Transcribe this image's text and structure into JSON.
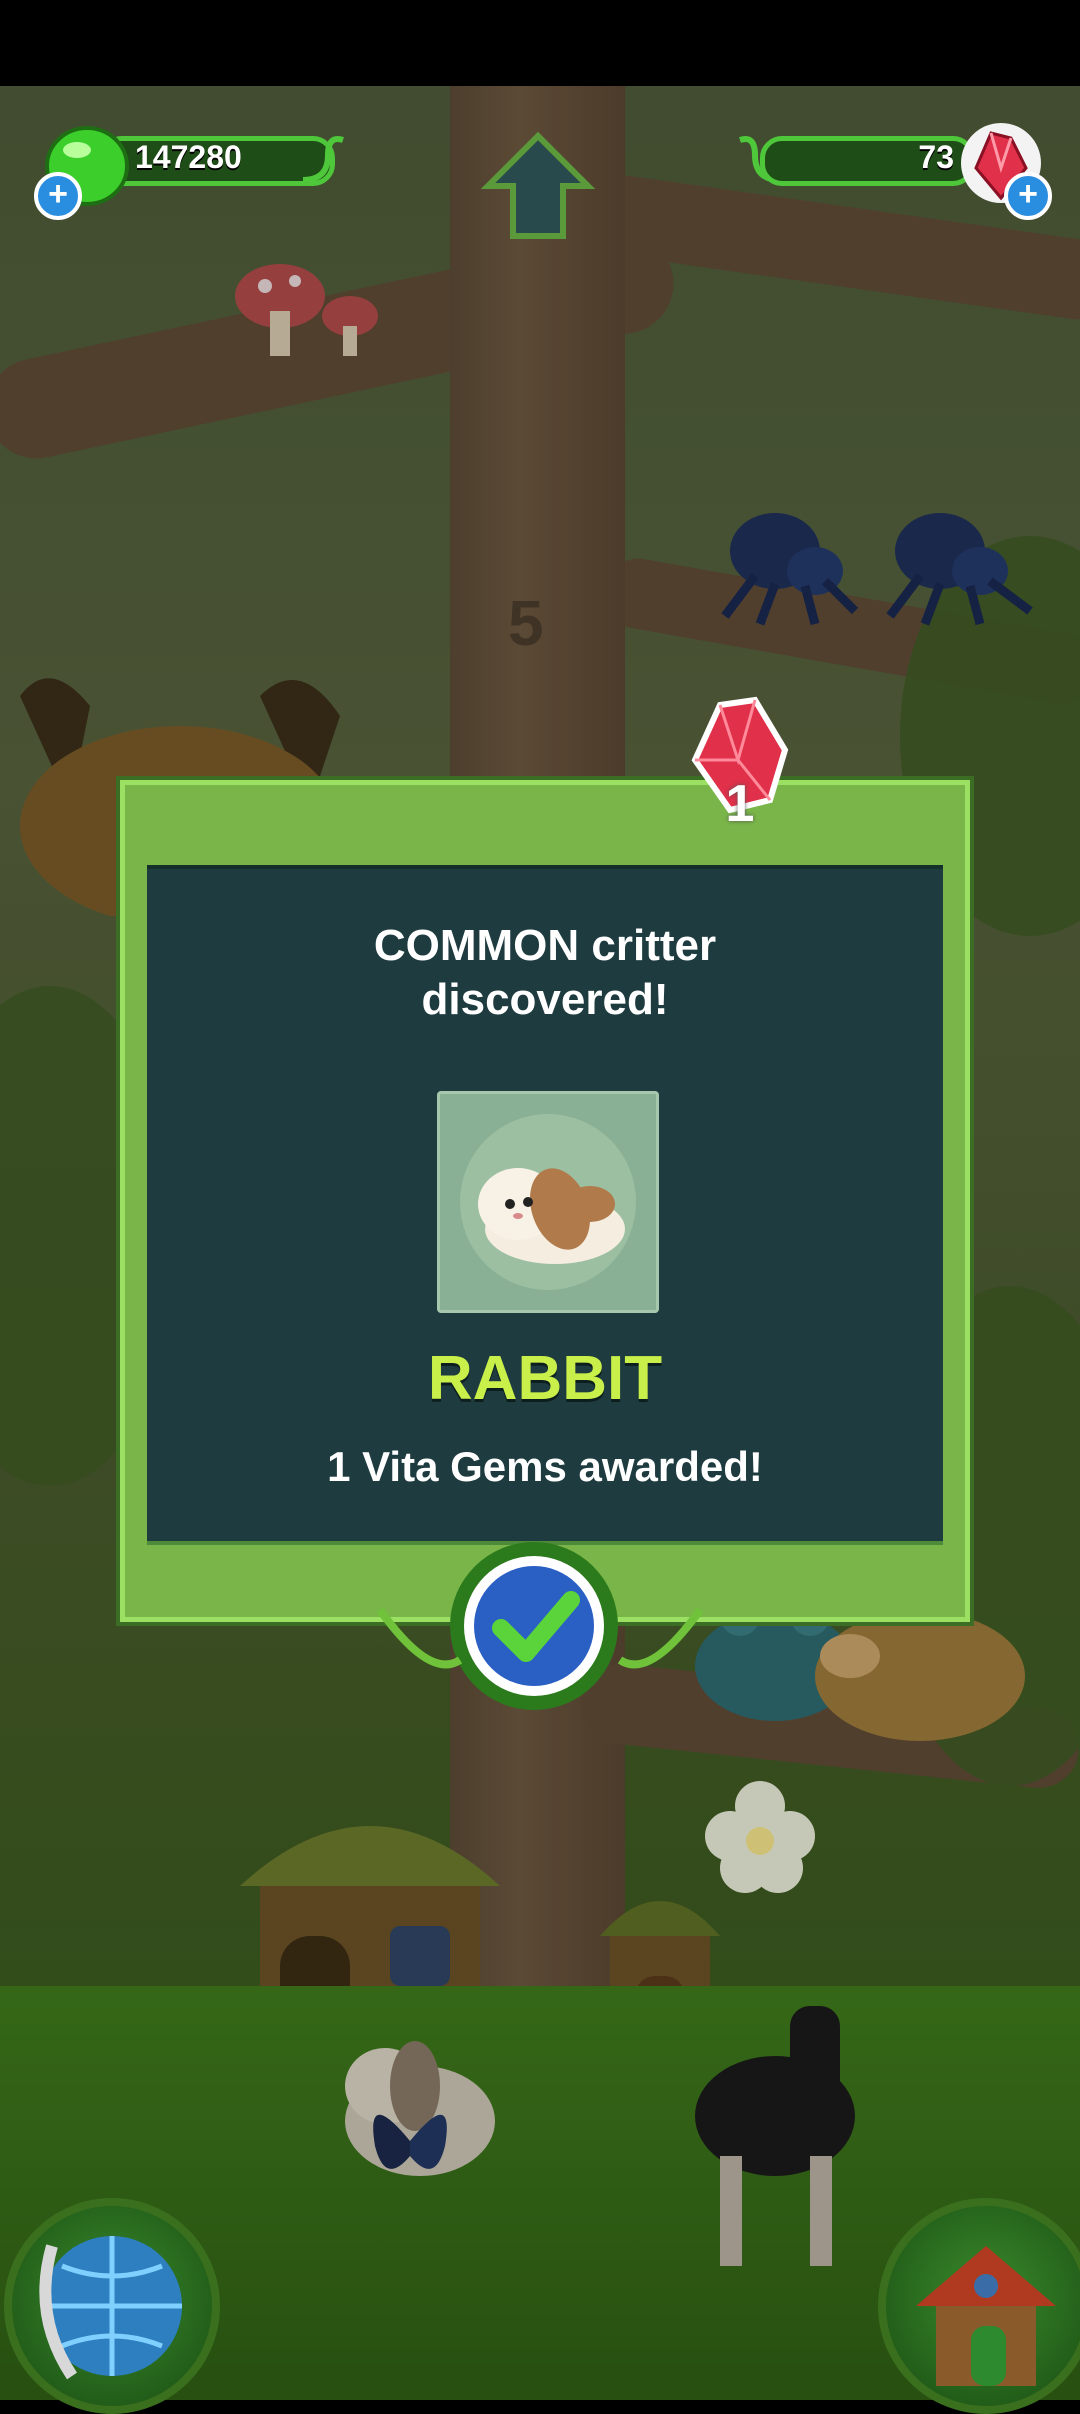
{
  "status_bar": {},
  "currency": {
    "seeds": "147280",
    "gems": "73"
  },
  "modal": {
    "gem_reward_badge": "1",
    "message_line1": "COMMON critter",
    "message_line2": "discovered!",
    "critter_name": "RABBIT",
    "award_text": "1 Vita Gems awarded!"
  },
  "scene": {
    "branch_number": "5"
  },
  "icons": {
    "up_arrow": "up-arrow-icon",
    "confirm": "checkmark-icon",
    "globe": "globe-icon",
    "house": "house-icon"
  },
  "colors": {
    "modal_green": "#79b548",
    "modal_panel": "#1e3b3f",
    "critter_name": "#c9ef4a",
    "gem_red": "#e0304a"
  }
}
